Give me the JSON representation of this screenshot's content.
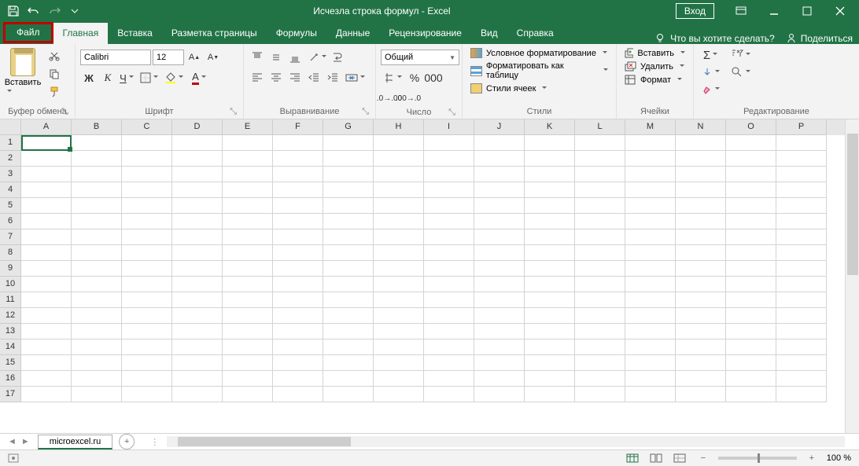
{
  "titlebar": {
    "title": "Исчезла строка формул  -  Excel",
    "login": "Вход"
  },
  "tabs": {
    "file": "Файл",
    "home": "Главная",
    "insert": "Вставка",
    "pagelayout": "Разметка страницы",
    "formulas": "Формулы",
    "data": "Данные",
    "review": "Рецензирование",
    "view": "Вид",
    "help": "Справка",
    "tellme": "Что вы хотите сделать?",
    "share": "Поделиться"
  },
  "ribbon": {
    "clipboard": {
      "label": "Буфер обмена",
      "paste": "Вставить"
    },
    "font": {
      "label": "Шрифт",
      "name": "Calibri",
      "size": "12"
    },
    "alignment": {
      "label": "Выравнивание"
    },
    "number": {
      "label": "Число",
      "format": "Общий"
    },
    "styles": {
      "label": "Стили",
      "cond": "Условное форматирование",
      "table": "Форматировать как таблицу",
      "cell": "Стили ячеек"
    },
    "cells": {
      "label": "Ячейки",
      "insert": "Вставить",
      "delete": "Удалить",
      "format": "Формат"
    },
    "editing": {
      "label": "Редактирование"
    }
  },
  "grid": {
    "cols": [
      "A",
      "B",
      "C",
      "D",
      "E",
      "F",
      "G",
      "H",
      "I",
      "J",
      "K",
      "L",
      "M",
      "N",
      "O",
      "P"
    ],
    "rows": [
      "1",
      "2",
      "3",
      "4",
      "5",
      "6",
      "7",
      "8",
      "9",
      "10",
      "11",
      "12",
      "13",
      "14",
      "15",
      "16",
      "17"
    ]
  },
  "sheet": {
    "name": "microexcel.ru"
  },
  "status": {
    "zoom": "100 %"
  }
}
